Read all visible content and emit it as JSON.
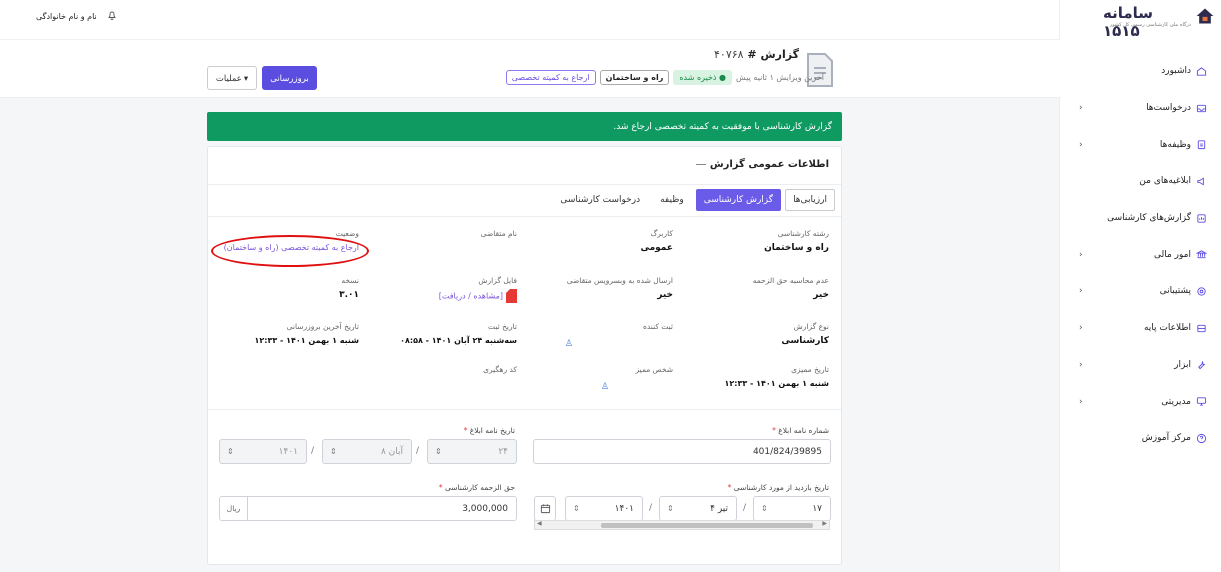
{
  "topbar": {
    "user_name": "نام و نام خانوادگی",
    "bell_icon": "bell-icon"
  },
  "brand": {
    "title": "سامانه ۱۵۱۵",
    "subtitle": "درگاه ملی کارشناسی رسمی کل کشور"
  },
  "nav": [
    {
      "label": "داشبورد",
      "icon": "home-icon",
      "chevron": false
    },
    {
      "label": "درخواست‌ها",
      "icon": "inbox-icon",
      "chevron": true
    },
    {
      "label": "وظیفه‌ها",
      "icon": "clipboard-icon",
      "chevron": true
    },
    {
      "label": "ابلاغیه‌های من",
      "icon": "megaphone-icon",
      "chevron": false
    },
    {
      "label": "گزارش‌های کارشناسی",
      "icon": "report-icon",
      "chevron": false
    },
    {
      "label": "امور مالی",
      "icon": "bank-icon",
      "chevron": true
    },
    {
      "label": "پشتیبانی",
      "icon": "support-icon",
      "chevron": true
    },
    {
      "label": "اطلاعات پایه",
      "icon": "database-icon",
      "chevron": true
    },
    {
      "label": "ابزار",
      "icon": "tools-icon",
      "chevron": true
    },
    {
      "label": "مدیریتی",
      "icon": "monitor-icon",
      "chevron": true
    },
    {
      "label": "مرکز آموزش",
      "icon": "help-icon",
      "chevron": false
    }
  ],
  "header": {
    "title_prefix": "گزارش",
    "title_hash": "#",
    "report_number": "۴۰۷۶۸",
    "badge_status": "ارجاع به کمیته تخصصی",
    "badge_field": "راه و ساختمان",
    "badge_saved": "ذخیره شده",
    "last_edit": "آخرین ویرایش ۱ ثانیه پیش",
    "update_button": "بروزرسانی",
    "ops_button": "عملیات"
  },
  "alert": {
    "text": "گزارش کارشناسی با موفقیت به کمیته تخصصی ارجاع شد."
  },
  "card": {
    "title": "اطلاعات عمومی گزارش",
    "tabs": [
      "درخواست کارشناسی",
      "وظیفه",
      "گزارش کارشناسی",
      "ارزیابی‌ها"
    ],
    "active_tab": "گزارش کارشناسی"
  },
  "info": {
    "field_label": "رشته کارشناسی",
    "field_value": "راه و ساختمان",
    "karbarg_label": "کاربرگ",
    "karbarg_value": "عمومی",
    "applicant_label": "نام متقاضی",
    "status_label": "وضعیت",
    "status_value": "ارجاع به کمیته تخصصی (راه و ساختمان)",
    "fee_calc_label": "عدم محاسبه حق الزحمه",
    "fee_calc_value": "خیر",
    "webservice_label": "ارسال شده به وبسرویس متقاضی",
    "webservice_value": "خیر",
    "file_label": "فایل گزارش",
    "file_value": "[مشاهده / دریافت]",
    "version_label": "نسخه",
    "version_value": "۳.۰۱",
    "type_label": "نوع گزارش",
    "type_value": "کارشناسی",
    "registrar_label": "ثبت کننده",
    "reg_date_label": "تاریخ ثبت",
    "reg_date_value": "سه‌شنبه ۲۴ آبان ۱۴۰۱ - ۰۸:۵۸",
    "last_update_label": "تاریخ آخرین بروزرسانی",
    "last_update_value": "شنبه ۱ بهمن ۱۴۰۱ - ۱۲:۳۳",
    "audit_date_label": "تاریخ ممیزی",
    "audit_date_value": "شنبه ۱ بهمن ۱۴۰۱ - ۱۲:۳۳",
    "auditor_label": "شخص ممیز",
    "tracking_label": "کد رهگیری"
  },
  "form": {
    "letter_no_label": "شماره نامه ابلاغ",
    "letter_no_value": "401/824/39895",
    "letter_date_label": "تاریخ نامه ابلاغ",
    "letter_day": "۲۴",
    "letter_month": "۸ آبان",
    "letter_year": "۱۴۰۱",
    "visit_date_label": "تاریخ بازدید از مورد کارشناسی",
    "visit_day": "۱۷",
    "visit_month": "۴ تیر",
    "visit_year": "۱۴۰۱",
    "fee_label": "حق الزحمه کارشناسی",
    "fee_value": "3,000,000",
    "fee_unit": "ریال",
    "required_mark": "*",
    "date_sep": "/",
    "spin_glyph": "⇕"
  }
}
